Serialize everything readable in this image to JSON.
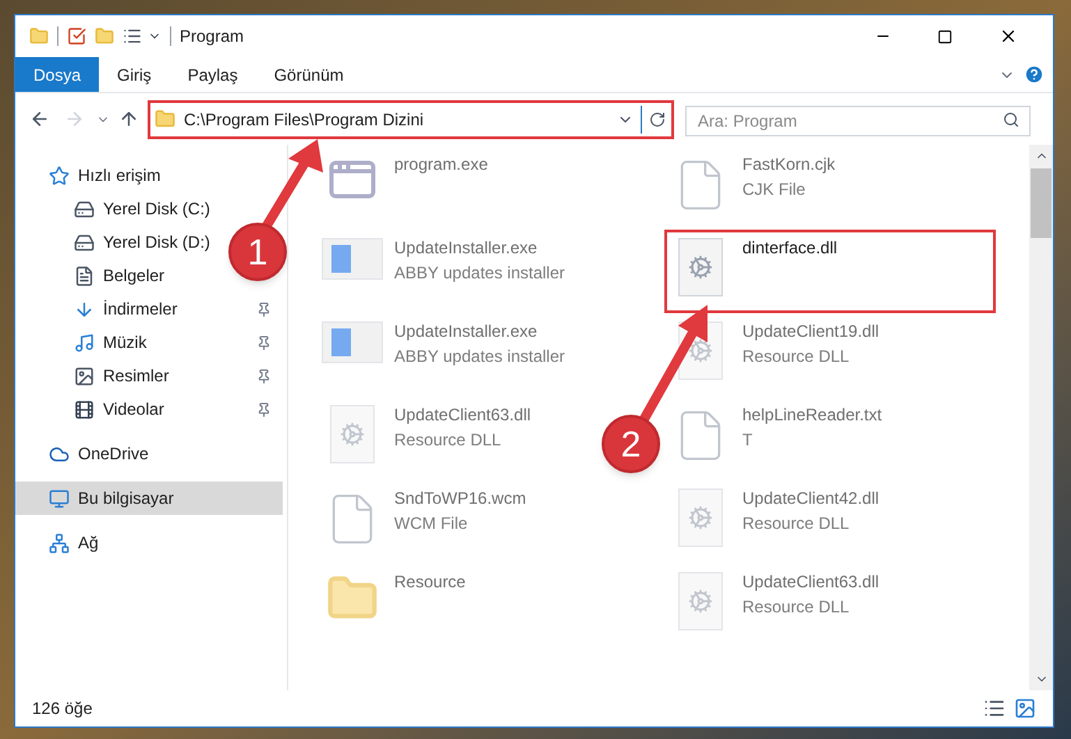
{
  "window": {
    "title": "Program"
  },
  "ribbon_tabs": [
    {
      "label": "Dosya",
      "selected": true
    },
    {
      "label": "Giriş",
      "selected": false
    },
    {
      "label": "Paylaş",
      "selected": false
    },
    {
      "label": "Görünüm",
      "selected": false
    }
  ],
  "address_bar": {
    "path": "C:\\Program Files\\Program Dizini",
    "highlighted": true
  },
  "search": {
    "placeholder": "Ara: Program"
  },
  "sidebar": {
    "items": [
      {
        "label": "Hızlı erişim",
        "kind": "star",
        "selected": false,
        "children": [
          {
            "label": "Yerel Disk (C:)",
            "kind": "drive",
            "pinned": false
          },
          {
            "label": "Yerel Disk (D:)",
            "kind": "drive",
            "pinned": false
          },
          {
            "label": "Belgeler",
            "kind": "documents",
            "pinned": false
          },
          {
            "label": "İndirmeler",
            "kind": "downloads",
            "pinned": true
          },
          {
            "label": "Müzik",
            "kind": "music",
            "pinned": true
          },
          {
            "label": "Resimler",
            "kind": "pictures",
            "pinned": true
          },
          {
            "label": "Videolar",
            "kind": "videos",
            "pinned": true
          }
        ]
      },
      {
        "label": "OneDrive",
        "kind": "cloud",
        "selected": false
      },
      {
        "label": "Bu bilgisayar",
        "kind": "computer",
        "selected": true
      },
      {
        "label": "Ağ",
        "kind": "network",
        "selected": false
      }
    ]
  },
  "files": {
    "columns": [
      [
        {
          "name": "program.exe",
          "kind": "app",
          "highlighted": false
        },
        {
          "name": "UpdateInstaller.exe",
          "type": "ABBY updates installer",
          "kind": "installer",
          "highlighted": false
        },
        {
          "name": "UpdateInstaller.exe",
          "type": "ABBY updates installer",
          "kind": "installer",
          "highlighted": false
        },
        {
          "name": "UpdateClient63.dll",
          "type": "Resource DLL",
          "kind": "dll",
          "highlighted": false
        },
        {
          "name": "SndToWP16.wcm",
          "type": "WCM File",
          "kind": "file",
          "highlighted": false
        },
        {
          "name": "Resource",
          "kind": "folder",
          "highlighted": false
        }
      ],
      [
        {
          "name": "FastKorn.cjk",
          "type": "CJK File",
          "kind": "file",
          "highlighted": false
        },
        {
          "name": "dinterface.dll",
          "kind": "dll",
          "highlighted": true
        },
        {
          "name": "UpdateClient19.dll",
          "type": "Resource DLL",
          "kind": "dll",
          "highlighted": false
        },
        {
          "name": "helpLineReader.txt",
          "type": "T",
          "kind": "file",
          "highlighted": false
        },
        {
          "name": "UpdateClient42.dll",
          "type": "Resource DLL",
          "kind": "dll",
          "highlighted": false
        },
        {
          "name": "UpdateClient63.dll",
          "type": "Resource DLL",
          "kind": "dll",
          "highlighted": false
        }
      ]
    ]
  },
  "status_bar": {
    "count": "126 öğe"
  },
  "annotations": [
    {
      "label": "1"
    },
    {
      "label": "2"
    }
  ]
}
